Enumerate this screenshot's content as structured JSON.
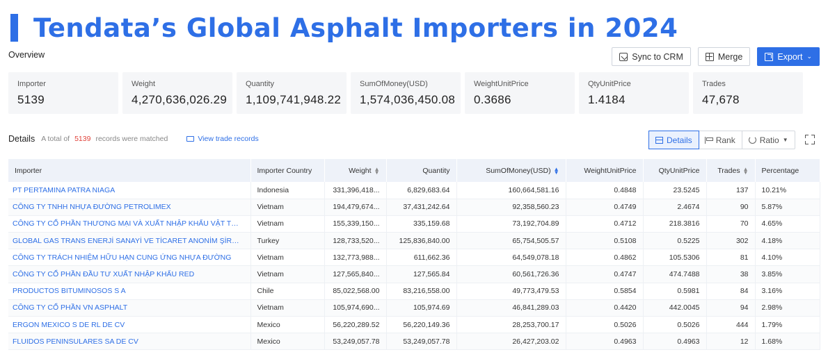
{
  "banner": {
    "title": "Tendata’s Global Asphalt Importers in 2024"
  },
  "overview": {
    "label": "Overview"
  },
  "actions": {
    "sync": "Sync to CRM",
    "merge": "Merge",
    "export": "Export"
  },
  "stats": [
    {
      "label": "Importer",
      "value": "5139"
    },
    {
      "label": "Weight",
      "value": "4,270,636,026.29"
    },
    {
      "label": "Quantity",
      "value": "1,109,741,948.22"
    },
    {
      "label": "SumOfMoney(USD)",
      "value": "1,574,036,450.08"
    },
    {
      "label": "WeightUnitPrice",
      "value": "0.3686"
    },
    {
      "label": "QtyUnitPrice",
      "value": "1.4184"
    },
    {
      "label": "Trades",
      "value": "47,678"
    }
  ],
  "details": {
    "heading": "Details",
    "prefix": "A total of",
    "count": "5139",
    "suffix": "records were matched",
    "view_link": "View trade records"
  },
  "view_tabs": {
    "details": "Details",
    "rank": "Rank",
    "ratio": "Ratio"
  },
  "table": {
    "headers": [
      "Importer",
      "Importer Country",
      "Weight",
      "Quantity",
      "SumOfMoney(USD)",
      "WeightUnitPrice",
      "QtyUnitPrice",
      "Trades",
      "Percentage"
    ],
    "rows": [
      [
        "PT PERTAMINA PATRA NIAGA",
        "Indonesia",
        "331,396,418...",
        "6,829,683.64",
        "160,664,581.16",
        "0.4848",
        "23.5245",
        "137",
        "10.21%"
      ],
      [
        "CÔNG TY TNHH NHỰA ĐƯỜNG PETROLIMEX",
        "Vietnam",
        "194,479,674...",
        "37,431,242.64",
        "92,358,560.23",
        "0.4749",
        "2.4674",
        "90",
        "5.87%"
      ],
      [
        "CÔNG TY CỔ PHẦN THƯƠNG MẠI VÀ XUẤT NHẬP KHẨU VẬT TƯ GIAO T...",
        "Vietnam",
        "155,339,150...",
        "335,159.68",
        "73,192,704.89",
        "0.4712",
        "218.3816",
        "70",
        "4.65%"
      ],
      [
        "GLOBAL GAS TRANS ENERJİ SANAYİ VE TİCARET ANONİM ŞİRKETİ",
        "Turkey",
        "128,733,520...",
        "125,836,840.00",
        "65,754,505.57",
        "0.5108",
        "0.5225",
        "302",
        "4.18%"
      ],
      [
        "CÔNG TY TRÁCH NHIỆM HỮU HẠN CUNG ỨNG NHỰA ĐƯỜNG",
        "Vietnam",
        "132,773,988...",
        "611,662.36",
        "64,549,078.18",
        "0.4862",
        "105.5306",
        "81",
        "4.10%"
      ],
      [
        "CÔNG TY CỔ PHẦN ĐẦU TƯ XUẤT NHẬP KHẨU RED",
        "Vietnam",
        "127,565,840...",
        "127,565.84",
        "60,561,726.36",
        "0.4747",
        "474.7488",
        "38",
        "3.85%"
      ],
      [
        "PRODUCTOS BITUMINOSOS S A",
        "Chile",
        "85,022,568.00",
        "83,216,558.00",
        "49,773,479.53",
        "0.5854",
        "0.5981",
        "84",
        "3.16%"
      ],
      [
        "CÔNG TY CỔ PHẦN VN ASPHALT",
        "Vietnam",
        "105,974,690...",
        "105,974.69",
        "46,841,289.03",
        "0.4420",
        "442.0045",
        "94",
        "2.98%"
      ],
      [
        "ERGON MEXICO S DE RL DE CV",
        "Mexico",
        "56,220,289.52",
        "56,220,149.36",
        "28,253,700.17",
        "0.5026",
        "0.5026",
        "444",
        "1.79%"
      ],
      [
        "FLUIDOS PENINSULARES SA DE CV",
        "Mexico",
        "53,249,057.78",
        "53,249,057.78",
        "26,427,203.02",
        "0.4963",
        "0.4963",
        "12",
        "1.68%"
      ]
    ]
  },
  "colors": {
    "accent": "#2e6fe6",
    "count_red": "#e0423a",
    "header_bg": "#eef2f9"
  }
}
